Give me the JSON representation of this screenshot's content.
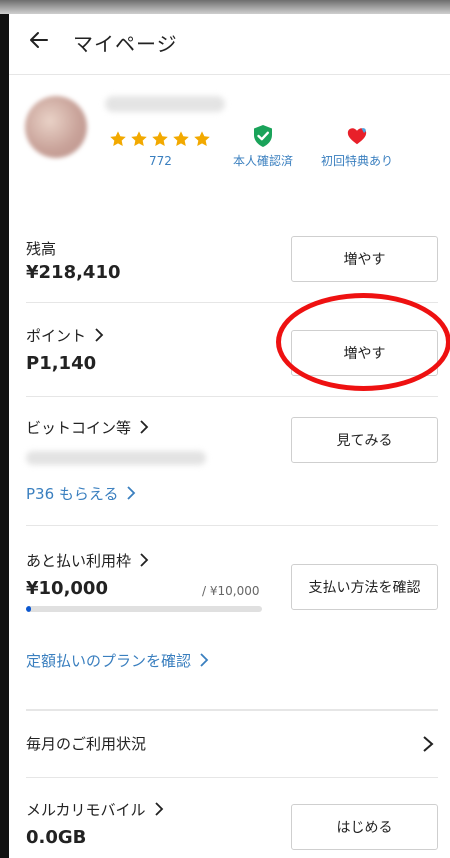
{
  "header": {
    "title": "マイページ",
    "back_icon": "arrow-left-icon"
  },
  "profile": {
    "rating_count": "772",
    "badges": [
      {
        "icon": "shield-check-icon",
        "label": "本人確認済",
        "color": "#1aa35a"
      },
      {
        "icon": "heart-icon",
        "label": "初回特典あり",
        "color": "#e8202a"
      }
    ]
  },
  "balance": {
    "label": "残高",
    "value": "¥218,410",
    "button": "増やす"
  },
  "points": {
    "label": "ポイント",
    "value": "P1,140",
    "button": "増やす"
  },
  "bitcoin": {
    "label": "ビットコイン等",
    "promo": "P36 もらえる",
    "button": "見てみる"
  },
  "deferred": {
    "label": "あと払い利用枠",
    "value": "¥10,000",
    "limit": "/ ¥10,000",
    "progress": 0.02,
    "button": "支払い方法を確認",
    "plan_link": "定額払いのプランを確認"
  },
  "monthly": {
    "label": "毎月のご利用状況"
  },
  "mobile": {
    "label": "メルカリモバイル",
    "value": "0.0GB",
    "button": "はじめる"
  },
  "colors": {
    "link": "#3a7fbf",
    "star": "#f2a900",
    "highlight": "#ee1111",
    "progress": "#0b57d0"
  }
}
